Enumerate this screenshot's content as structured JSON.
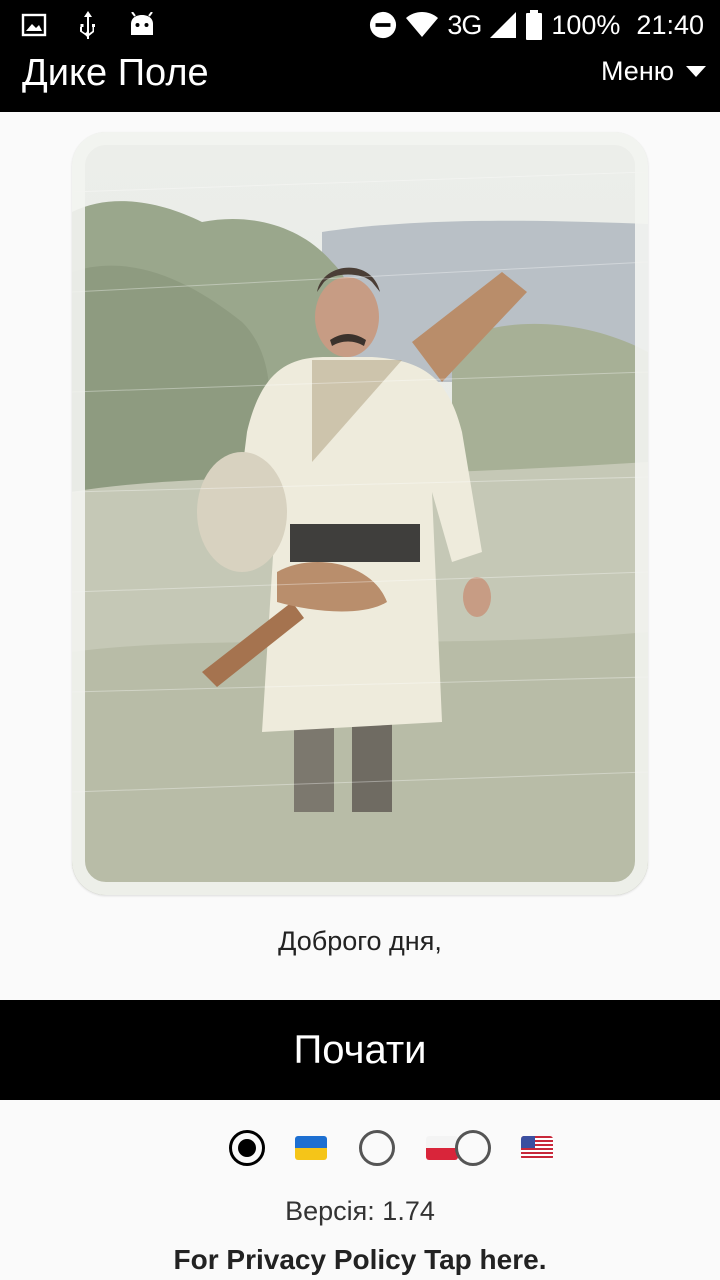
{
  "status_bar": {
    "battery": "100%",
    "time": "21:40",
    "network": "3G",
    "icons": [
      "image-icon",
      "usb-icon",
      "android-icon",
      "do-not-disturb-icon",
      "wifi-icon",
      "signal-icon",
      "battery-icon"
    ]
  },
  "app_bar": {
    "title": "Дике Поле",
    "menu_label": "Меню"
  },
  "card": {
    "image_subject": "cossack-photo"
  },
  "greeting": "Доброго дня,",
  "start_button": "Почати",
  "languages": {
    "selected": "ukrainian",
    "options": [
      "ukrainian",
      "polish",
      "english"
    ],
    "flags": [
      "ukraine-flag-icon",
      "poland-flag-icon",
      "usa-flag-icon"
    ]
  },
  "version_text": "Версія: 1.74",
  "privacy_text": "For Privacy Policy Tap here.",
  "colors": {
    "bar_bg": "#000000",
    "page_bg": "#fafafa"
  }
}
